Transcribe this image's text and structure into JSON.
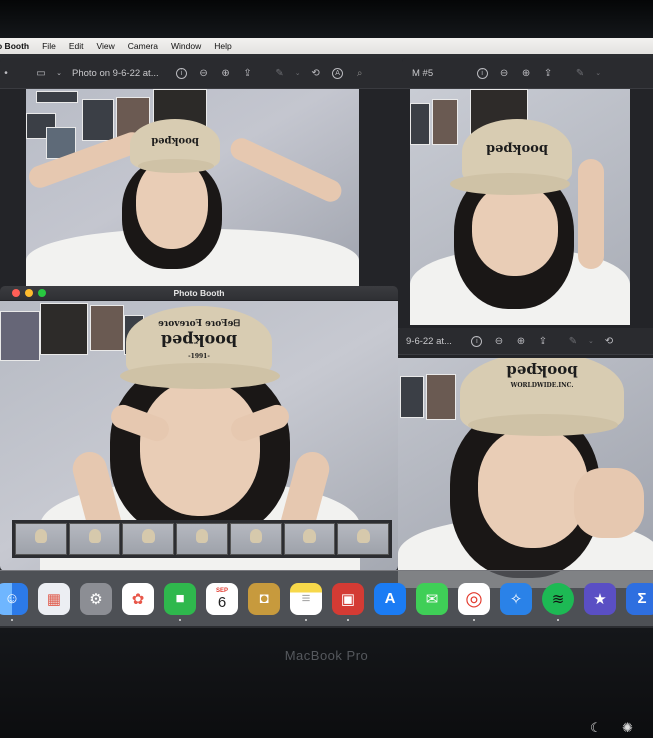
{
  "menubar": {
    "app_name": "o Booth",
    "items": [
      "File",
      "Edit",
      "View",
      "Camera",
      "Window",
      "Help"
    ]
  },
  "preview_left": {
    "title": "Photo on 9-6-22 at..."
  },
  "preview_right": {
    "title": "M #5"
  },
  "preview_bottom": {
    "title": "9-6-22 at..."
  },
  "photo_booth": {
    "title": "Photo Booth"
  },
  "cap_text": {
    "main": "ɘɿovɘɿoꟻ ɘɿoꟻɘᗺ",
    "logo": "bookped",
    "sub": "WORLDWIDE.INC.",
    "year": "-1991-"
  },
  "dock": {
    "calendar_month": "SEP",
    "calendar_day": "6",
    "items": [
      {
        "name": "finder-icon",
        "glyph": "☺",
        "bg": "#3b8ff0"
      },
      {
        "name": "launchpad-icon",
        "glyph": "▦",
        "bg": "#e9e9ef"
      },
      {
        "name": "system-preferences-icon",
        "glyph": "⚙",
        "bg": "#8d8f95"
      },
      {
        "name": "photos-icon",
        "glyph": "✿",
        "bg": "#ffffff"
      },
      {
        "name": "facetime-icon",
        "glyph": "■",
        "bg": "#2fb84d"
      },
      {
        "name": "calendar-icon",
        "glyph": "",
        "bg": "#ffffff"
      },
      {
        "name": "gold-app-icon",
        "glyph": "◘",
        "bg": "#c79a3d"
      },
      {
        "name": "notes-icon",
        "glyph": "≡",
        "bg": "#f8e27a"
      },
      {
        "name": "photo-booth-icon",
        "glyph": "▣",
        "bg": "#d43b34"
      },
      {
        "name": "app-store-icon",
        "glyph": "A",
        "bg": "#1b7cf4"
      },
      {
        "name": "messages-icon",
        "glyph": "✉",
        "bg": "#3fcf57"
      },
      {
        "name": "chrome-icon",
        "glyph": "◎",
        "bg": "#ffffff"
      },
      {
        "name": "safari-icon",
        "glyph": "✧",
        "bg": "#2a82e8"
      },
      {
        "name": "spotify-icon",
        "glyph": "≋",
        "bg": "#1db954"
      },
      {
        "name": "imovie-icon",
        "glyph": "★",
        "bg": "#5a4fc4"
      },
      {
        "name": "sigma-app-icon",
        "glyph": "Σ",
        "bg": "#2e6fe0"
      }
    ]
  },
  "laptop": {
    "brand": "MacBook Pro"
  },
  "colors": {
    "close": "#ff5f57",
    "minimize": "#febc2e",
    "zoom": "#28c840"
  }
}
